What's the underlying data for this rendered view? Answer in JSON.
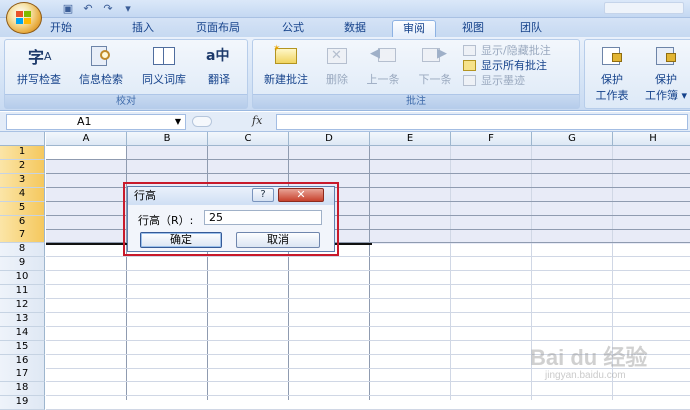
{
  "quick_access": [
    "save-icon",
    "undo-icon",
    "redo-icon",
    "customize-icon"
  ],
  "tabs": [
    {
      "label": "开始",
      "active": false
    },
    {
      "label": "插入",
      "active": false
    },
    {
      "label": "页面布局",
      "active": false
    },
    {
      "label": "公式",
      "active": false
    },
    {
      "label": "数据",
      "active": false
    },
    {
      "label": "审阅",
      "active": true
    },
    {
      "label": "视图",
      "active": false
    },
    {
      "label": "团队",
      "active": false
    }
  ],
  "ribbon": {
    "proofing": {
      "label": "校对",
      "buttons": [
        {
          "label": "拼写检查",
          "icon": "spellcheck-icon"
        },
        {
          "label": "信息检索",
          "icon": "research-icon"
        },
        {
          "label": "同义词库",
          "icon": "thesaurus-icon"
        },
        {
          "label": "翻译",
          "icon": "translate-icon"
        }
      ],
      "spell_glyph": "字",
      "translate_glyph": "a中"
    },
    "comments": {
      "label": "批注",
      "buttons": [
        {
          "label": "新建批注",
          "enabled": true
        },
        {
          "label": "删除",
          "enabled": false
        },
        {
          "label": "上一条",
          "enabled": false
        },
        {
          "label": "下一条",
          "enabled": false
        }
      ],
      "small": [
        {
          "label": "显示/隐藏批注",
          "enabled": false
        },
        {
          "label": "显示所有批注",
          "enabled": true
        },
        {
          "label": "显示墨迹",
          "enabled": false
        }
      ]
    },
    "changes": {
      "buttons": [
        {
          "line1": "保护",
          "line2": "工作表"
        },
        {
          "line1": "保护",
          "line2": "工作簿 ▾"
        }
      ]
    }
  },
  "formula_bar": {
    "name_box": "A1",
    "fx": "fx",
    "value": ""
  },
  "columns": [
    "A",
    "B",
    "C",
    "D",
    "E",
    "F",
    "G",
    "H"
  ],
  "rows": [
    "1",
    "2",
    "3",
    "4",
    "5",
    "6",
    "7",
    "8",
    "9",
    "10",
    "11",
    "12",
    "13",
    "14",
    "15",
    "16",
    "17",
    "18",
    "19"
  ],
  "selected_rows": 7,
  "dialog": {
    "title": "行高",
    "help": "?",
    "close": "✕",
    "field_label": "行高（R）:",
    "field_value": "25",
    "ok": "确定",
    "cancel": "取消"
  },
  "watermark": {
    "main": "Bai du 经验",
    "sub": "jingyan.baidu.com"
  }
}
